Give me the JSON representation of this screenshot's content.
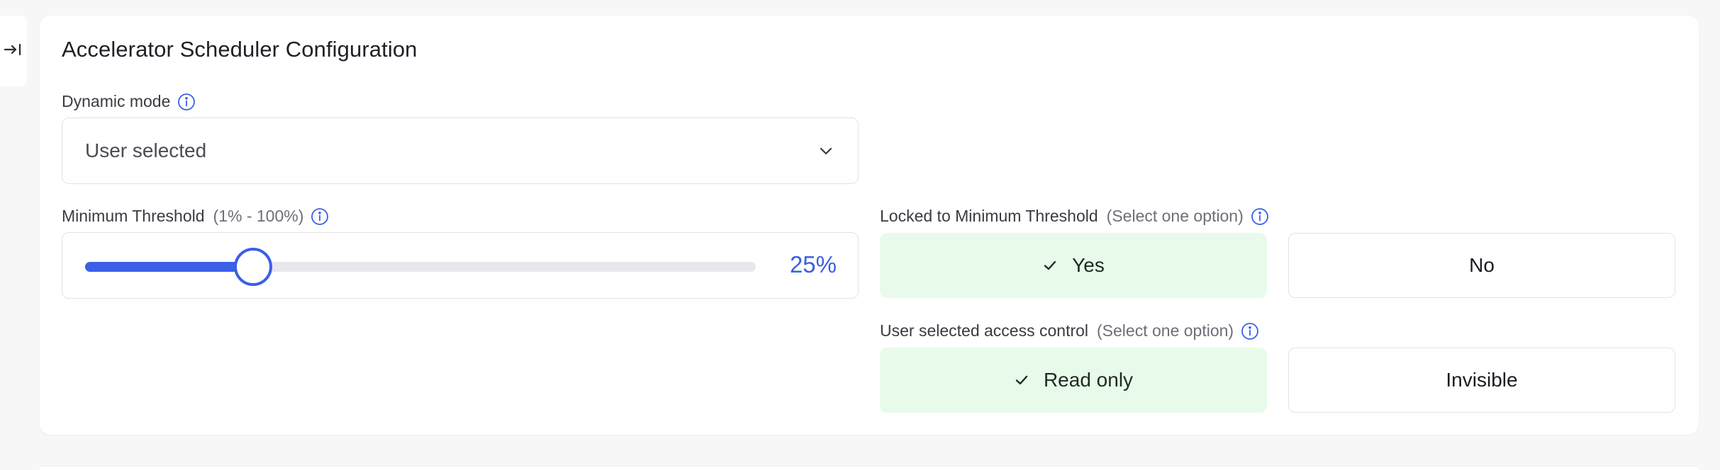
{
  "card": {
    "title": "Accelerator Scheduler Configuration"
  },
  "dynamic_mode": {
    "label": "Dynamic mode",
    "selected_value": "User selected"
  },
  "minimum_threshold": {
    "label": "Minimum Threshold",
    "range_hint": "(1% - 100%)",
    "value_text": "25%",
    "value_fraction": 0.25
  },
  "locked_to_minimum": {
    "label": "Locked to Minimum Threshold",
    "hint": "(Select one option)",
    "options": [
      {
        "label": "Yes",
        "selected": true
      },
      {
        "label": "No",
        "selected": false
      }
    ]
  },
  "access_control": {
    "label": "User selected access control",
    "hint": "(Select one option)",
    "options": [
      {
        "label": "Read only",
        "selected": true
      },
      {
        "label": "Invisible",
        "selected": false
      }
    ]
  },
  "icons": {
    "sidebar_toggle": "collapse-panel-icon",
    "info": "info-icon",
    "dropdown": "chevron-down-icon",
    "check": "check-icon"
  },
  "colors": {
    "accent": "#3b5fe6",
    "selected_bg": "#e8fbea",
    "border": "#e3e3e8"
  }
}
